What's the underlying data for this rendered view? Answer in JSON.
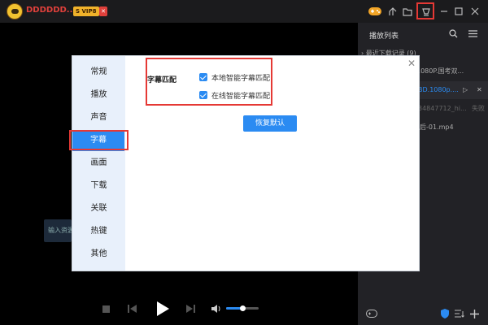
{
  "app": {
    "username": "DDDDDD...",
    "vip_label": "S VIP8",
    "vip_x": "✕",
    "logo_icon": "player-logo-icon"
  },
  "titlebar_icons": [
    "gamepad-icon",
    "share-icon",
    "folder-icon",
    "skin-icon",
    "minimize-icon",
    "maximize-icon",
    "close-icon"
  ],
  "settings": {
    "sidebar": [
      "常规",
      "播放",
      "声音",
      "字幕",
      "画面",
      "下载",
      "关联",
      "热键",
      "其他"
    ],
    "active_index": 3,
    "section_label": "字幕匹配",
    "options": [
      {
        "label": "本地智能字幕匹配",
        "checked": true
      },
      {
        "label": "在线智能字幕匹配",
        "checked": true
      }
    ],
    "restore_button": "恢复默认",
    "close": "✕"
  },
  "playlist": {
    "title": "播放列表",
    "items": [
      {
        "text": "› 最近下载记录 (9)",
        "active": false
      },
      {
        "text": "1080P.国考双...",
        "active": false
      },
      {
        "text": "BD.1080p....",
        "active": true
      },
      {
        "text": "34847712_hi...",
        "active": false,
        "extra": "失败"
      },
      {
        "text": "后-01.mp4",
        "active": false
      }
    ]
  },
  "video": {
    "input_tip": "输入资源",
    "volume": 0.5
  },
  "colors": {
    "accent": "#2b8bf2",
    "highlight": "#e53935",
    "brand": "#e0403b"
  }
}
